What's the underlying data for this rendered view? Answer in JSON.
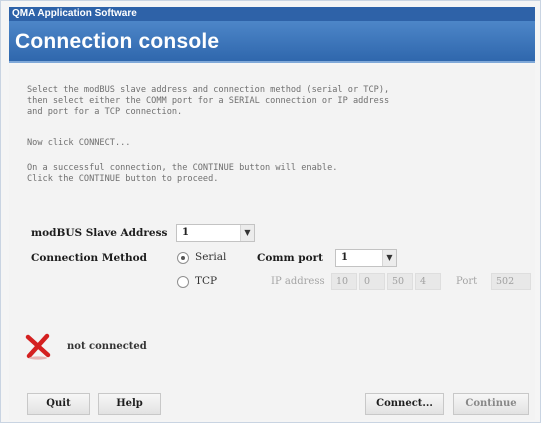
{
  "app": {
    "title": "QMA Application Software"
  },
  "header": {
    "title": "Connection console"
  },
  "instructions": {
    "para1": "Select the modBUS slave address and connection method (serial or TCP),\nthen select either the COMM port for a SERIAL connection or IP address\nand port for a TCP connection.",
    "para2": "Now click CONNECT...",
    "para3": "On a successful connection, the CONTINUE button will enable.\nClick the CONTINUE button to proceed."
  },
  "form": {
    "slave_address_label": "modBUS Slave Address",
    "slave_address_value": "1",
    "connection_method_label": "Connection Method",
    "serial_label": "Serial",
    "tcp_label": "TCP",
    "comm_port_label": "Comm port",
    "comm_port_value": "1",
    "ip_address_label": "IP address",
    "ip": [
      "10",
      "0",
      "50",
      "4"
    ],
    "port_label": "Port",
    "port_value": "502",
    "selected_method": "Serial"
  },
  "status": {
    "text": "not connected",
    "icon": "red-x-icon",
    "color": "#d42020"
  },
  "buttons": {
    "quit": "Quit",
    "help": "Help",
    "connect": "Connect...",
    "continue": "Continue"
  },
  "colors": {
    "title_bar": "#2e62a8",
    "header": "#3a74b9",
    "accent_text": "#ffffff"
  }
}
